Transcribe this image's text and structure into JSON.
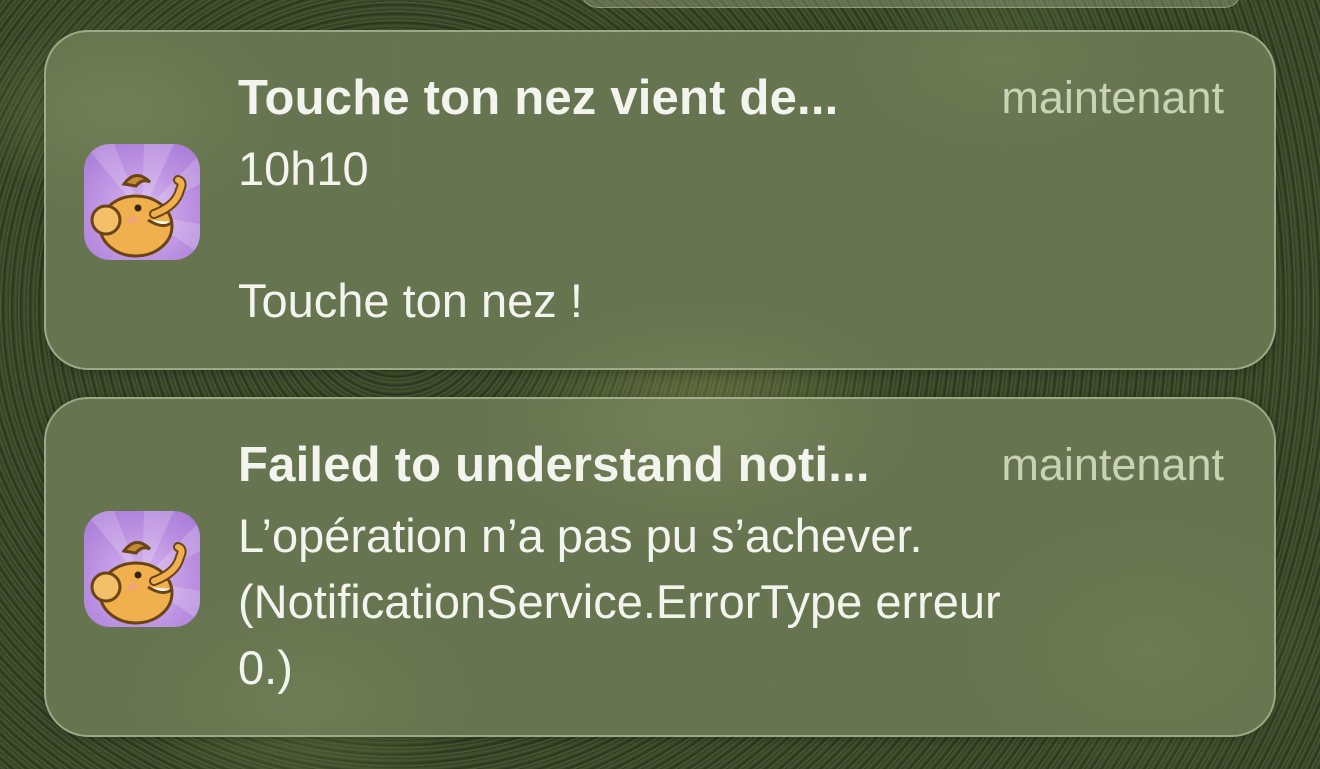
{
  "notifications": [
    {
      "app_icon": "elephant-app-icon",
      "title": "Touche ton nez vient de...",
      "time": "maintenant",
      "lines": [
        "10h10",
        "",
        "Touche ton nez !"
      ]
    },
    {
      "app_icon": "elephant-app-icon",
      "title": "Failed to understand noti...",
      "time": "maintenant",
      "lines": [
        "L’opération n’a pas pu s’achever.",
        "(NotificationService.ErrorType erreur",
        "0.)"
      ]
    }
  ],
  "colors": {
    "card_background": "#78875f",
    "icon_background": "#b98ee0",
    "text": "#f4f4ef"
  }
}
